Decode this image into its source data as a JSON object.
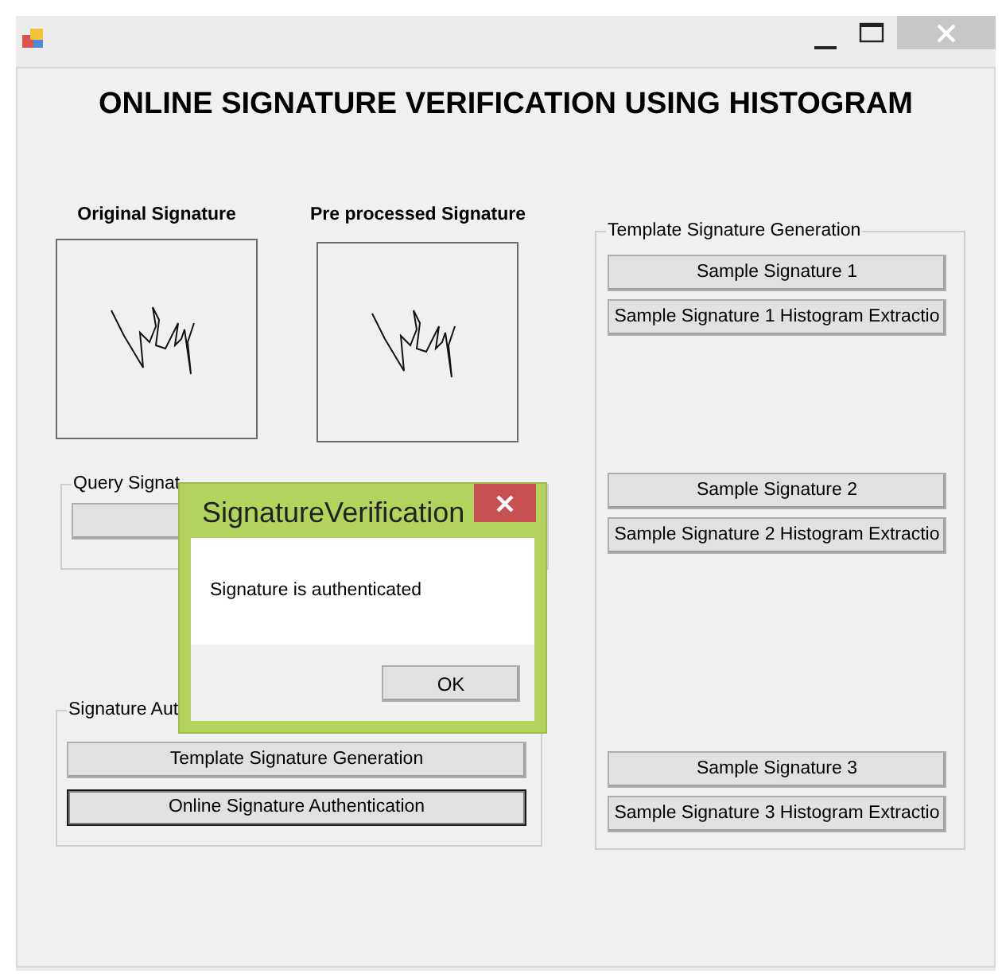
{
  "heading": "ONLINE SIGNATURE VERIFICATION USING HISTOGRAM",
  "images": [
    {
      "label": "Original Signature"
    },
    {
      "label": "Pre processed Signature"
    }
  ],
  "query_group": {
    "title": "Query Signat"
  },
  "auth_group": {
    "title": "Signature Aut",
    "buttons": [
      {
        "label": "Template Signature Generation",
        "default": false
      },
      {
        "label": "Online Signature Authentication",
        "default": true
      }
    ]
  },
  "template_group": {
    "title": "Template Signature Generation",
    "samples": [
      {
        "sample_button": "Sample Signature 1",
        "histogram_button": "Sample Signature 1 Histogram Extractio"
      },
      {
        "sample_button": "Sample Signature 2",
        "histogram_button": "Sample Signature 2 Histogram Extractio"
      },
      {
        "sample_button": "Sample Signature 3",
        "histogram_button": "Sample Signature 3 Histogram Extractio"
      }
    ]
  },
  "dialog": {
    "title": "SignatureVerification",
    "message": "Signature is authenticated",
    "button": "OK"
  }
}
